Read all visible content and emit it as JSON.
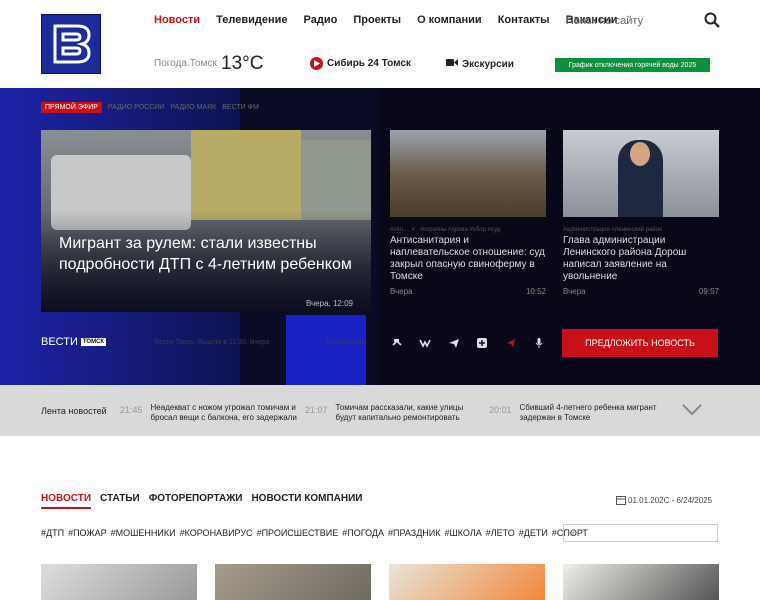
{
  "header": {
    "logo_icon": "vesti-logo-icon",
    "nav": [
      "Новости",
      "Телевидение",
      "Радио",
      "Проекты",
      "О компании",
      "Контакты",
      "Вакансии"
    ],
    "search_placeholder": "Поиск по сайту",
    "weather_label": "Погода.Томск",
    "temperature": "13°C",
    "live_channel": "Сибирь 24 Томск",
    "tours": "Экскурсии",
    "hot_water_button": "График отключения горячей воды 2025"
  },
  "hero": {
    "live_tag": "ПРЯМОЙ ЭФИР",
    "stations": [
      "РАДИО РОССИИ",
      "РАДИО МАЯК",
      "ВЕСТИ ФМ"
    ],
    "main": {
      "title": "Мигрант за рулем: стали известны подробности ДТП с 4-летним ребенком",
      "time": "Вчера, 12:09"
    },
    "card2": {
      "tags": "#сёл..., #.. #корзины #дрова #сбор #суд",
      "title": "Антисанитария и наплевательское отношение: суд закрыл опасную свиноферму в Томске",
      "date": "Вчера",
      "time": "10:52"
    },
    "card3": {
      "tags": "#администрация #ленинский район",
      "title": "Глава администрации Ленинского района Дорош написал заявление на увольнение",
      "date": "Вчера",
      "time": "09:57"
    },
    "vesti_label": "ВЕСТИ",
    "vesti_tomsk": "ТОМСК",
    "faint_text1": "Вести Томск. Вышли в 11:30. Вчера",
    "faint_text2": "Все выпуски",
    "suggest_button": "ПРЕДЛОЖИТЬ НОВОСТЬ"
  },
  "ticker": {
    "label": "Лента новостей",
    "items": [
      {
        "time": "21:45",
        "text": "Неадекват с ножом угрожал томичам и бросал вещи с балкона, его задержали"
      },
      {
        "time": "21:07",
        "text": "Томичам рассказали, какие улицы будут капитально ремонтировать"
      },
      {
        "time": "20:01",
        "text": "Сбивший 4-летнего ребенка мигрант задержан в Томске"
      }
    ]
  },
  "news": {
    "tabs": [
      "НОВОСТИ",
      "СТАТЬИ",
      "ФОТОРЕПОРТАЖИ",
      "НОВОСТИ КОМПАНИИ"
    ],
    "date_range": "01.01.202C - 6/24/2025",
    "hashtags": [
      "#ДТП",
      "#ПОЖАР",
      "#МОШЕННИКИ",
      "#КОРОНАВИРУС",
      "#ПРОИСШЕСТВИЕ",
      "#ПОГОДА",
      "#ПРАЗДНИК",
      "#ШКОЛА",
      "#ЛЕТО",
      "#ДЕТИ",
      "#СПОРТ"
    ],
    "hashtag_search_placeholder": "#"
  }
}
